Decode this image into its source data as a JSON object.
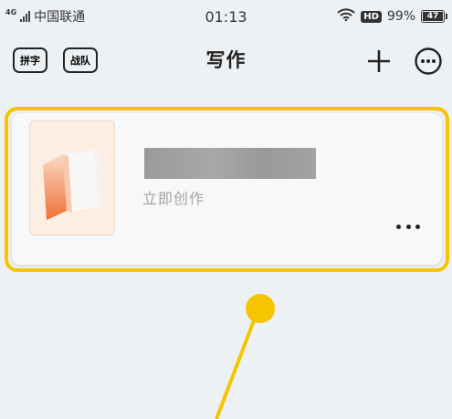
{
  "status_bar": {
    "network": "4G",
    "carrier": "中国联通",
    "time": "01:13",
    "hd_label": "HD",
    "battery_percent": "99%",
    "battery_level": "47"
  },
  "header": {
    "pinzi_label": "拼字",
    "zhandui_label": "战队",
    "title": "写作",
    "icons": [
      "plus-icon",
      "more-circle-icon"
    ]
  },
  "card": {
    "subtitle": "立即创作",
    "icons": [
      "book-cover-icon",
      "more-dots-icon"
    ]
  },
  "colors": {
    "highlight": "#f6c500",
    "background": "#eef1f4",
    "cover_bg": "#fdeee4",
    "cover_accent": "#f07a40"
  }
}
